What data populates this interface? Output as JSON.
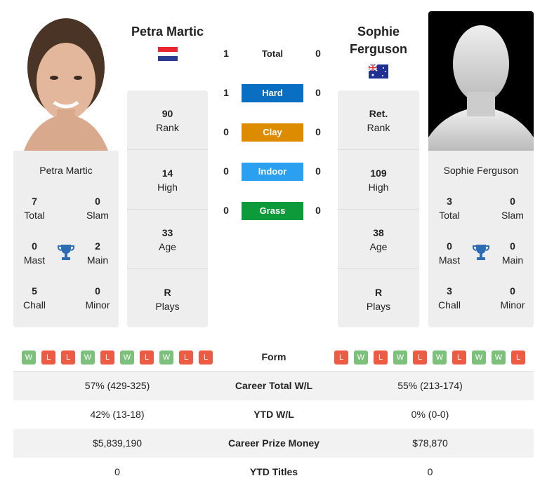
{
  "player1": {
    "name": "Petra Martic",
    "flag": "Croatia",
    "card": {
      "total": "7",
      "slam": "0",
      "mast": "0",
      "main": "2",
      "chall": "5",
      "minor": "0"
    },
    "stats": {
      "rank": "90",
      "high": "14",
      "age": "33",
      "plays": "R"
    }
  },
  "player2": {
    "name": "Sophie Ferguson",
    "flag": "Australia",
    "card": {
      "total": "3",
      "slam": "0",
      "mast": "0",
      "main": "0",
      "chall": "3",
      "minor": "0"
    },
    "stats": {
      "rank": "Ret.",
      "high": "109",
      "age": "38",
      "plays": "R"
    }
  },
  "labels": {
    "total": "Total",
    "slam": "Slam",
    "mast": "Mast",
    "main": "Main",
    "chall": "Chall",
    "minor": "Minor",
    "rank": "Rank",
    "high": "High",
    "age": "Age",
    "plays": "Plays"
  },
  "h2h": [
    {
      "label": "Total",
      "p1": "1",
      "p2": "0",
      "color": ""
    },
    {
      "label": "Hard",
      "p1": "1",
      "p2": "0",
      "color": "#0a6ec2"
    },
    {
      "label": "Clay",
      "p1": "0",
      "p2": "0",
      "color": "#dd8c00"
    },
    {
      "label": "Indoor",
      "p1": "0",
      "p2": "0",
      "color": "#2b9ff0"
    },
    {
      "label": "Grass",
      "p1": "0",
      "p2": "0",
      "color": "#0c9a3a"
    }
  ],
  "form": {
    "label": "Form",
    "p1": [
      "W",
      "L",
      "L",
      "W",
      "L",
      "W",
      "L",
      "W",
      "L",
      "L"
    ],
    "p2": [
      "L",
      "W",
      "L",
      "W",
      "L",
      "W",
      "L",
      "W",
      "W",
      "L"
    ]
  },
  "rows": [
    {
      "label": "Career Total W/L",
      "p1": "57% (429-325)",
      "p2": "55% (213-174)"
    },
    {
      "label": "YTD W/L",
      "p1": "42% (13-18)",
      "p2": "0% (0-0)"
    },
    {
      "label": "Career Prize Money",
      "p1": "$5,839,190",
      "p2": "$78,870"
    },
    {
      "label": "YTD Titles",
      "p1": "0",
      "p2": "0"
    }
  ]
}
